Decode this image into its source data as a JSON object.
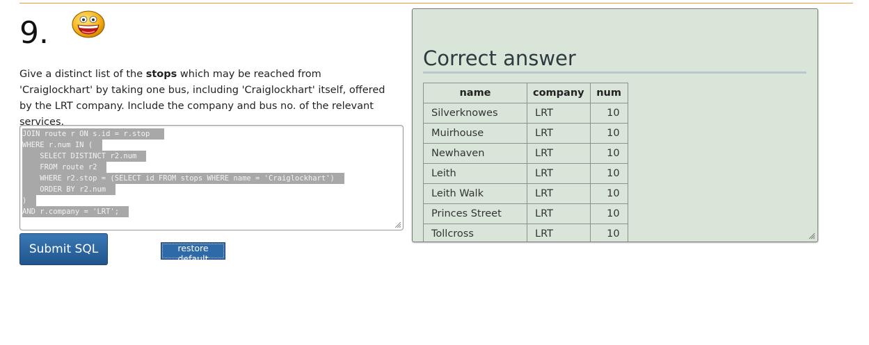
{
  "question": {
    "number": "9.",
    "text_before": "Give a distinct list of the ",
    "text_bold": "stops",
    "text_after": " which may be reached from 'Craiglockhart' by taking one bus, including 'Craiglockhart' itself, offered by the LRT company. Include the company and bus no. of the relevant services."
  },
  "sql_editor": {
    "lines": [
      "JOIN route r ON s.id = r.stop ",
      "WHERE r.num IN (",
      "    SELECT DISTINCT r2.num",
      "    FROM route r2",
      "    WHERE r2.stop = (SELECT id FROM stops WHERE name = 'Craiglockhart')",
      "    ORDER BY r2.num",
      ")",
      "AND r.company = 'LRT';"
    ]
  },
  "buttons": {
    "submit_label": "Submit SQL",
    "restore_label": "restore default"
  },
  "answer": {
    "title": "Correct answer",
    "headers": [
      "name",
      "company",
      "num"
    ],
    "rows": [
      [
        "Silverknowes",
        "LRT",
        "10"
      ],
      [
        "Muirhouse",
        "LRT",
        "10"
      ],
      [
        "Newhaven",
        "LRT",
        "10"
      ],
      [
        "Leith",
        "LRT",
        "10"
      ],
      [
        "Leith Walk",
        "LRT",
        "10"
      ],
      [
        "Princes Street",
        "LRT",
        "10"
      ],
      [
        "Tollcross",
        "LRT",
        "10"
      ]
    ]
  },
  "icons": {
    "smiley": "grinning-smiley-icon",
    "resize": "resize-grip-icon"
  },
  "colors": {
    "accent_rule": "#e89a3c",
    "button_blue": "#2d6aa7",
    "panel_bg": "#dae5d9"
  }
}
